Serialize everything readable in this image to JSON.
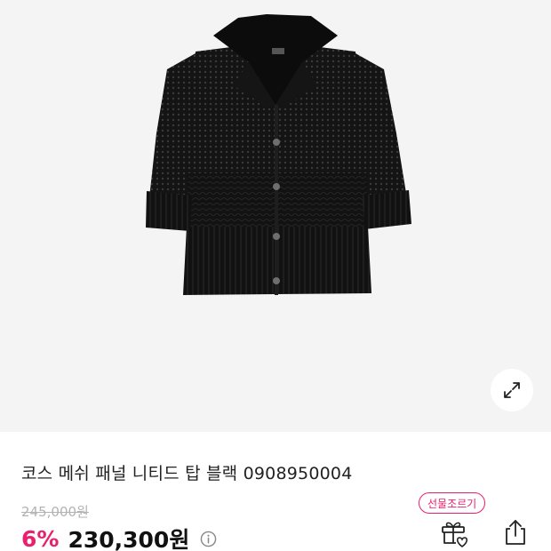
{
  "product": {
    "title": "코스 메쉬 패널 니티드 탑 블랙 0908950004",
    "original_price": "245,000원",
    "discount": "6%",
    "sale_price": "230,300원",
    "image_icon": "black-knit-cardigan-image"
  },
  "actions": {
    "gift_badge": "선물조르기",
    "gift_icon": "gift-heart-icon",
    "share_icon": "share-icon",
    "expand_icon": "expand-icon",
    "info_icon": "info-icon"
  },
  "colors": {
    "accent": "#e8206e",
    "background": "#f4f4f4",
    "text": "#222222",
    "muted": "#b3b3b3"
  }
}
